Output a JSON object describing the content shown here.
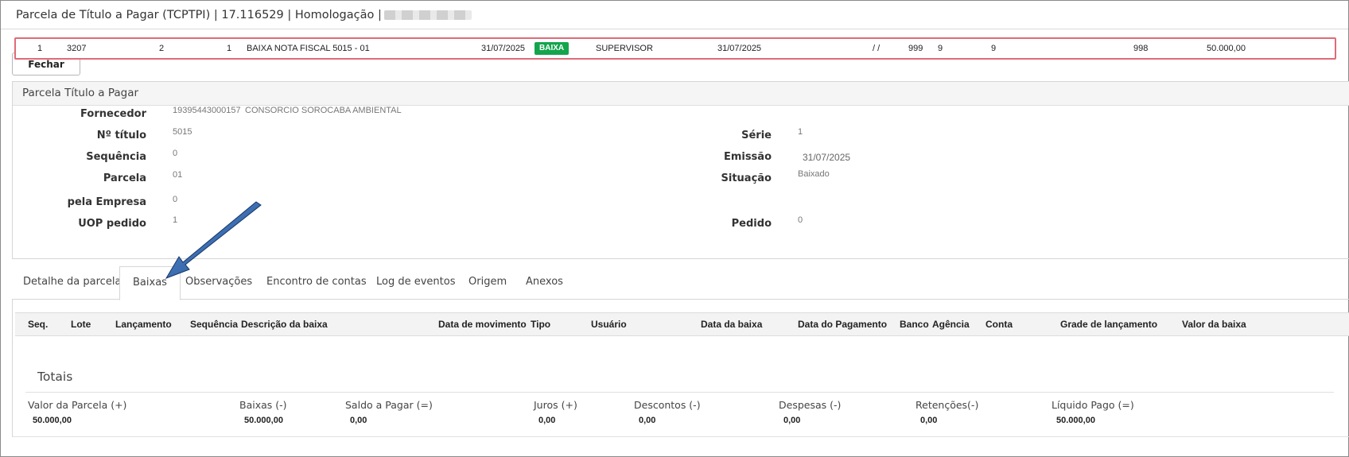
{
  "window": {
    "title": "Parcela de Título a Pagar (TCPTPI) | 17.116529 | Homologação |"
  },
  "toolbar": {
    "close_label": "Fechar"
  },
  "panel": {
    "header": "Parcela Título a Pagar",
    "fields": {
      "fornecedor": {
        "label": "Fornecedor",
        "code": "19395443000157",
        "name": "CONSORCIO SOROCABA AMBIENTAL"
      },
      "numero_titulo": {
        "label": "Nº título",
        "value": "5015"
      },
      "sequencia": {
        "label": "Sequência",
        "value": "0"
      },
      "parcela": {
        "label": "Parcela",
        "value": "01"
      },
      "pela_empresa": {
        "label": "pela Empresa",
        "value": "0"
      },
      "uop_pedido": {
        "label": "UOP pedido",
        "value": "1"
      },
      "serie": {
        "label": "Série",
        "value": "1"
      },
      "emissao": {
        "label": "Emissão",
        "value": "31/07/2025"
      },
      "situacao": {
        "label": "Situação",
        "value": "Baixado"
      },
      "pedido": {
        "label": "Pedido",
        "value": "0"
      }
    }
  },
  "tabs": [
    {
      "label": "Detalhe da parcela",
      "active": false
    },
    {
      "label": "Baixas",
      "active": true
    },
    {
      "label": "Observações",
      "active": false
    },
    {
      "label": "Encontro de contas",
      "active": false
    },
    {
      "label": "Log de eventos",
      "active": false
    },
    {
      "label": "Origem",
      "active": false
    },
    {
      "label": "Anexos",
      "active": false
    }
  ],
  "grid": {
    "columns": [
      "Seq.",
      "Lote",
      "Lançamento",
      "Sequência",
      "Descrição da baixa",
      "Data de movimento",
      "Tipo",
      "Usuário",
      "Data da baixa",
      "Data do Pagamento",
      "Banco",
      "Agência",
      "Conta",
      "Grade de lançamento",
      "Valor da baixa"
    ],
    "rows": [
      {
        "seq": "1",
        "lote": "3207",
        "lancamento": "2",
        "sequencia": "1",
        "descricao": "BAIXA NOTA FISCAL 5015 - 01",
        "data_movimento": "31/07/2025",
        "tipo": "BAIXA",
        "usuario": "SUPERVISOR",
        "data_baixa": "31/07/2025",
        "data_pagamento": "/ /",
        "banco": "999",
        "agencia": "9",
        "conta": "9",
        "grade": "998",
        "valor": "50.000,00"
      }
    ],
    "badge_color": "#14a44d",
    "highlight_color": "#e06b78"
  },
  "totais": {
    "title": "Totais",
    "items": [
      {
        "label": "Valor da Parcela (+)",
        "value": "50.000,00"
      },
      {
        "label": "Baixas (-)",
        "value": "50.000,00"
      },
      {
        "label": "Saldo a Pagar (=)",
        "value": "0,00"
      },
      {
        "label": "Juros (+)",
        "value": "0,00"
      },
      {
        "label": "Descontos (-)",
        "value": "0,00"
      },
      {
        "label": "Despesas (-)",
        "value": "0,00"
      },
      {
        "label": "Retenções(-)",
        "value": "0,00"
      },
      {
        "label": "Líquido Pago (=)",
        "value": "50.000,00"
      }
    ]
  },
  "annotation": {
    "arrow_color": "#1f4e8c"
  }
}
